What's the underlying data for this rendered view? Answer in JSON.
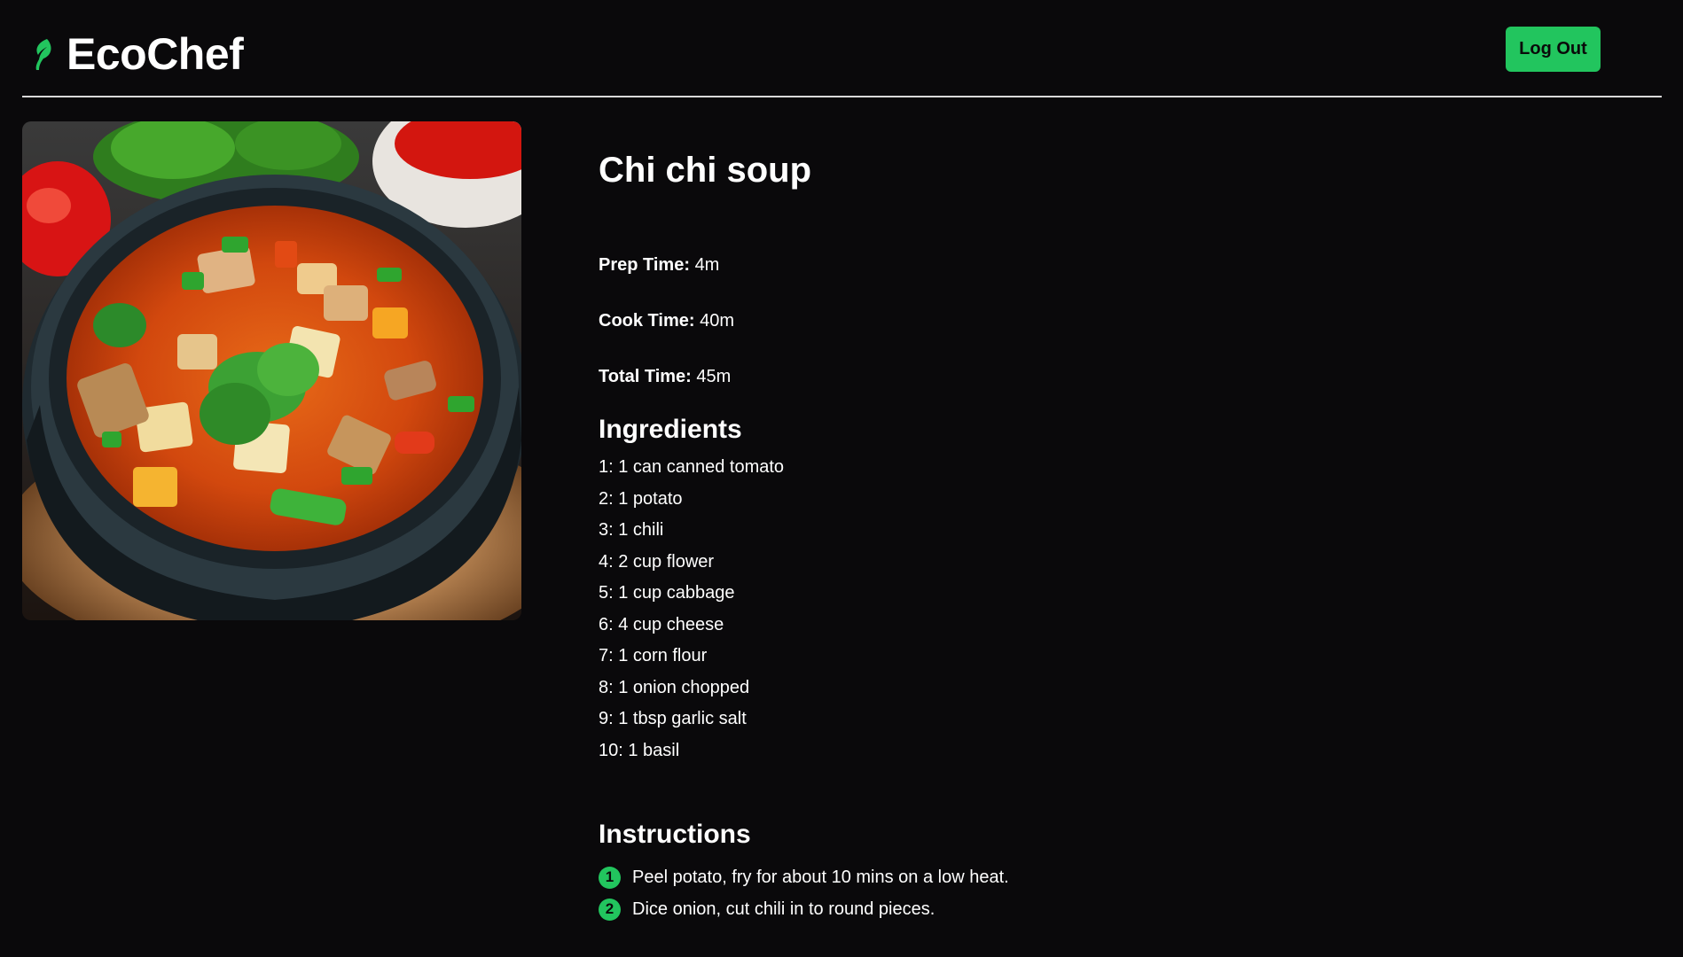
{
  "app": {
    "name": "EcoChef",
    "logo_icon": "leaf-icon",
    "accent_color": "#22c55e",
    "background_color": "#0a090b"
  },
  "header": {
    "logout_label": "Log Out"
  },
  "recipe": {
    "image_icon": "soup-bowl-photo",
    "title": "Chi chi soup",
    "prep": {
      "label": "Prep Time:",
      "value": "4m"
    },
    "cook": {
      "label": "Cook Time:",
      "value": "40m"
    },
    "total": {
      "label": "Total Time:",
      "value": "45m"
    },
    "ingredients_title": "Ingredients",
    "ingredients": [
      "1: 1 can canned tomato",
      "2: 1 potato",
      "3: 1 chili",
      "4: 2 cup flower",
      "5: 1 cup cabbage",
      "6: 4 cup cheese",
      "7: 1 corn flour",
      "8: 1 onion chopped",
      "9: 1 tbsp garlic salt",
      "10: 1 basil"
    ],
    "instructions_title": "Instructions",
    "instructions": [
      {
        "number": "1",
        "text": "Peel potato, fry for about 10 mins on a low heat."
      },
      {
        "number": "2",
        "text": "Dice onion, cut chili in to round pieces."
      }
    ]
  }
}
